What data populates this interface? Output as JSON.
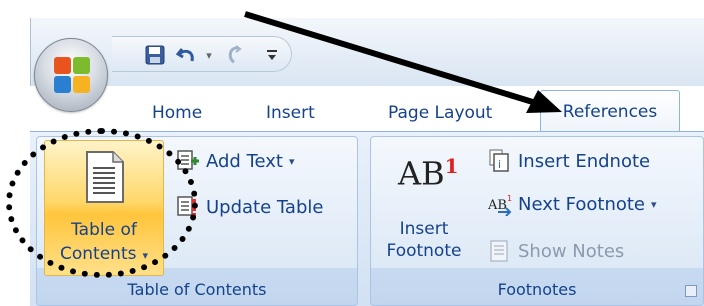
{
  "tabs": [
    {
      "label": "Home"
    },
    {
      "label": "Insert"
    },
    {
      "label": "Page Layout"
    },
    {
      "label": "References",
      "active": true
    }
  ],
  "quick_access_toolbar": {
    "save_icon": "save-icon",
    "undo_icon": "undo-icon",
    "redo_icon": "redo-icon",
    "customize_icon": "customize-qat-icon"
  },
  "groups": {
    "toc": {
      "label": "Table of Contents",
      "big_button_line1": "Table of",
      "big_button_line2": "Contents",
      "add_text": "Add Text",
      "update_table": "Update Table"
    },
    "footnotes": {
      "label": "Footnotes",
      "ab_glyph": "AB",
      "superscript": "1",
      "insert_footnote_line1": "Insert",
      "insert_footnote_line2": "Footnote",
      "insert_endnote": "Insert Endnote",
      "next_footnote": "Next Footnote",
      "show_notes": "Show Notes"
    }
  },
  "colors": {
    "tab_text": "#15428b",
    "active_button": "#ffd86b",
    "ribbon_bg": "#dde9f6"
  }
}
